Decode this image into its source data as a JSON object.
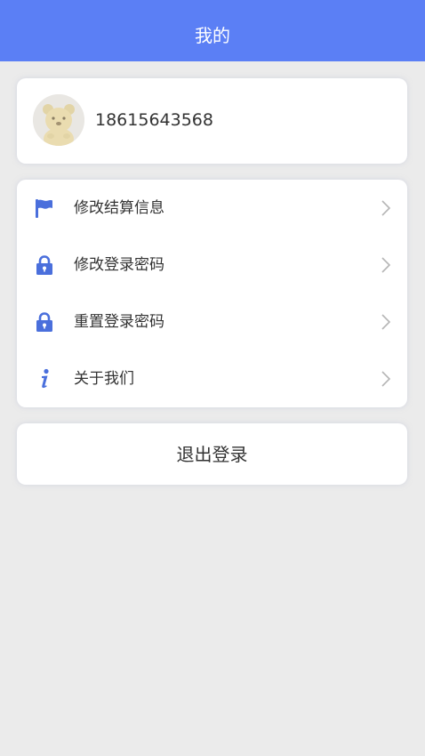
{
  "header": {
    "title": "我的",
    "color": "#5b7ff5"
  },
  "profile": {
    "avatar_icon": "bear-avatar",
    "phone": "18615643568"
  },
  "menu": {
    "icon_color": "#4a6fdc",
    "items": [
      {
        "icon": "flag-icon",
        "label": "修改结算信息"
      },
      {
        "icon": "lock-icon",
        "label": "修改登录密码"
      },
      {
        "icon": "lock-icon",
        "label": "重置登录密码"
      },
      {
        "icon": "info-icon",
        "label": "关于我们"
      }
    ]
  },
  "logout": {
    "label": "退出登录"
  }
}
